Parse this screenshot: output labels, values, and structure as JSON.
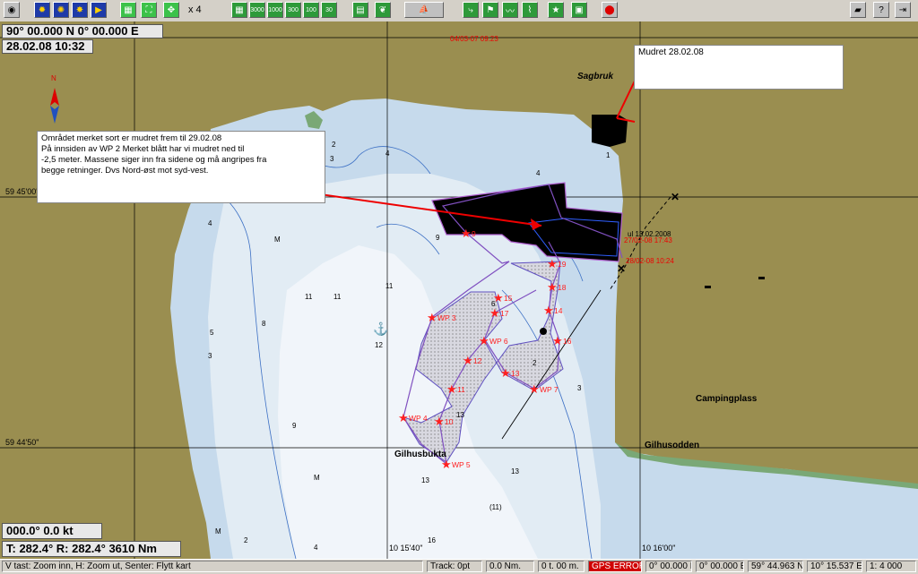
{
  "toolbar": {
    "zoom_label": "x 4",
    "scale_buttons": [
      "3000",
      "1000",
      "300",
      "100",
      "30"
    ]
  },
  "position": {
    "latlon": "90° 00.000 N    0° 00.000 E",
    "datetime": "28.02.08  10:32"
  },
  "heading": {
    "line1": "000.0°    0.0 kt",
    "line2": "T: 282.4°  R: 282.4°  3610 Nm"
  },
  "note_top": {
    "text": "Mudret 28.02.08"
  },
  "note_main": {
    "lines": [
      "Området merket sort er mudret frem til 29.02.08",
      "På innsiden av WP 2 Merket blått har vi mudret ned til",
      "-2,5 meter. Massene siger inn fra sidene og må angripes fra",
      "begge retninger. Dvs Nord-øst mot syd-vest."
    ]
  },
  "map": {
    "north_label": "N",
    "place_names": {
      "sagbruk": "Sagbruk",
      "campingplass": "Campingplass",
      "gilhusodden": "Gilhusodden",
      "gilhusbukta": "Gilhusbukta"
    },
    "lat_labels": [
      "59 45'00\"",
      "59 44'50\""
    ],
    "lon_labels": [
      "10 15'40\"",
      "10 16'00\""
    ],
    "track_labels": [
      "04/03-07 09.23",
      "27/02-08 17:43",
      "28/02-08 10:24",
      "ul 13.02.2008"
    ],
    "waypoints": [
      "WP 3",
      "WP 4",
      "WP 5",
      "WP 6",
      "WP 7",
      "10",
      "11",
      "12",
      "13",
      "14",
      "16",
      "17",
      "18",
      "19",
      "15",
      "9"
    ],
    "depths": [
      "2",
      "4",
      "3",
      "1",
      "4",
      "9",
      "11",
      "11",
      "11",
      "12",
      "13",
      "13",
      "13",
      "3",
      "5",
      "8",
      "9",
      "6",
      "4",
      "2",
      "3",
      "4",
      "2",
      "16",
      "M",
      "M",
      "M",
      "(11)"
    ]
  },
  "status": {
    "hint": "V tast: Zoom inn, H: Zoom ut, Senter: Flytt kart",
    "track": "Track: 0pt",
    "dist": "0.0 Nm.",
    "time": "0 t.  00 m.",
    "gps": "GPS ERROR",
    "gps_lat": "0° 00.000 N",
    "gps_lon": "0° 00.000 E",
    "cur_lat": "59° 44.963 N",
    "cur_lon": "10° 15.537 E",
    "scale": "1: 4 000"
  },
  "colors": {
    "land": "#9a8e50",
    "water_shallow": "#e2ecf4",
    "water_deep": "#c6daec",
    "dredged": "#000000",
    "marker": "#ff2020",
    "gps_error_bg": "#d00000"
  }
}
